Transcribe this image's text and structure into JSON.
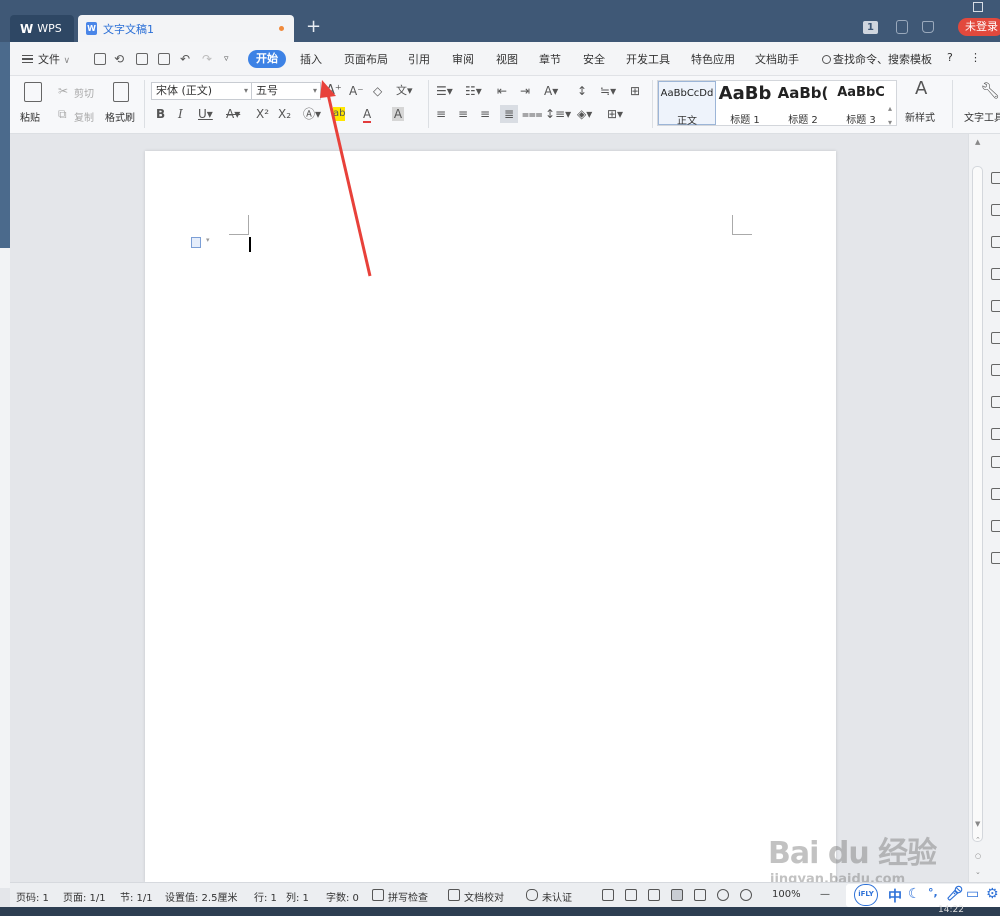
{
  "window": {
    "home_tab": "WPS",
    "doc_tab": "文字文稿1",
    "new_tab": "+",
    "badge": "1",
    "login": "未登录"
  },
  "menu": {
    "file": "文件",
    "items": [
      "开始",
      "插入",
      "页面布局",
      "引用",
      "审阅",
      "视图",
      "章节",
      "安全",
      "开发工具",
      "特色应用",
      "文档助手"
    ],
    "search": "查找命令、搜索模板",
    "help": "?",
    "more": "⋮"
  },
  "ribbon": {
    "paste": "粘贴",
    "cut": "剪切",
    "copy": "复制",
    "format_painter": "格式刷",
    "font_name": "宋体 (正文)",
    "font_size": "五号",
    "styles": [
      {
        "sample": "AaBbCcDd",
        "name": "正文"
      },
      {
        "sample": "AaBb",
        "name": "标题 1"
      },
      {
        "sample": "AaBb(",
        "name": "标题 2"
      },
      {
        "sample": "AaBbC",
        "name": "标题 3"
      }
    ],
    "new_style": "新样式",
    "text_tools": "文字工具"
  },
  "status": {
    "page_num": "页码: 1",
    "pages": "页面: 1/1",
    "section": "节: 1/1",
    "setting": "设置值: 2.5厘米",
    "row": "行: 1",
    "col": "列: 1",
    "words": "字数: 0",
    "spell": "拼写检查",
    "proof": "文档校对",
    "cert": "未认证",
    "zoom": "100%"
  },
  "ime": {
    "logo": "iFLY",
    "lang": "中"
  },
  "watermark": {
    "line1": "Bai du 经验",
    "line2": "jingyan.baidu.com"
  },
  "taskbar_time": "14:22"
}
